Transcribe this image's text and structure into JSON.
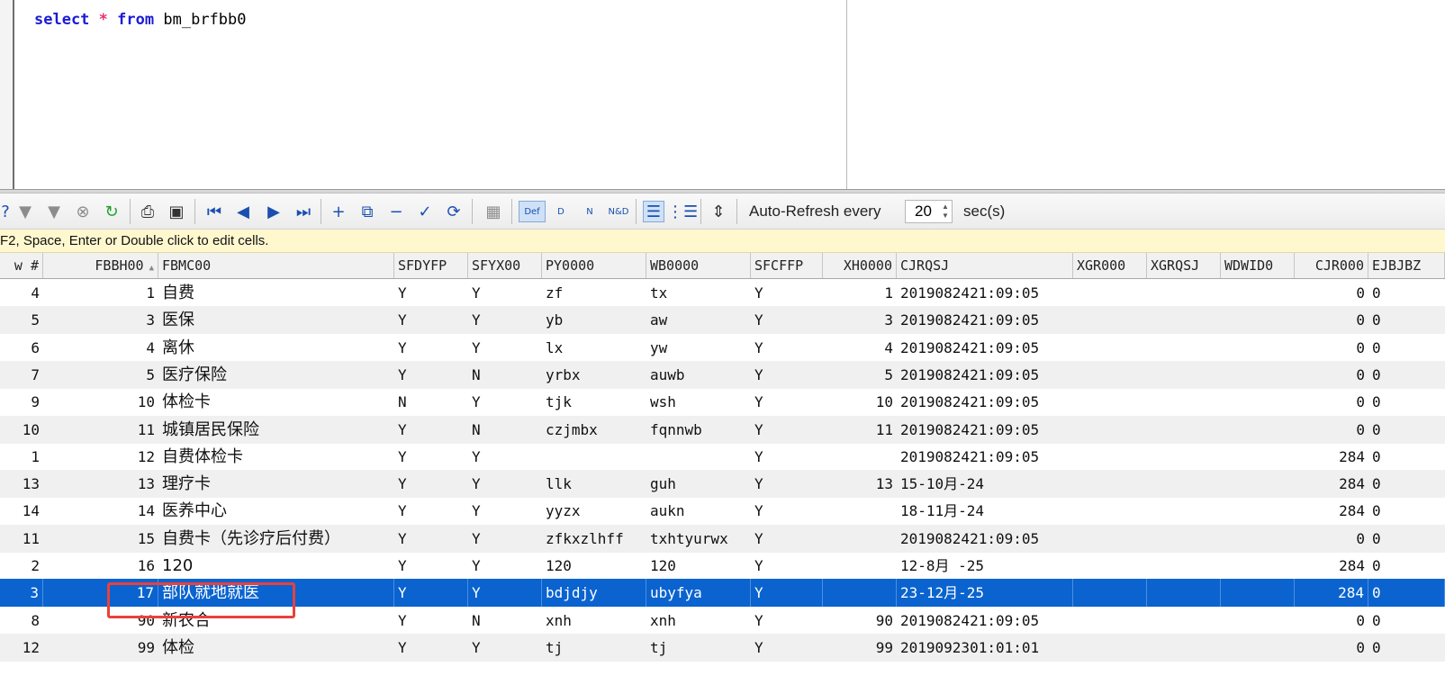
{
  "editor": {
    "sql_keyword_select": "select",
    "sql_star": "*",
    "sql_keyword_from": "from",
    "sql_table": "bm_brfbb0"
  },
  "toolbar": {
    "icons": [
      "help-icon",
      "filter-icon",
      "clear-filter-icon",
      "cancel-icon",
      "refresh-icon",
      "print-icon",
      "save-icon",
      "first-record-icon",
      "prior-record-icon",
      "next-record-icon",
      "last-record-icon",
      "insert-icon",
      "duplicate-icon",
      "delete-icon",
      "post-icon",
      "refresh-record-icon",
      "clear-icon",
      "default-view-icon",
      "d-view-icon",
      "n-view-icon",
      "nd-view-icon",
      "grid-view-icon",
      "form-view-icon",
      "fit-columns-icon"
    ],
    "btn_def_label": "Def",
    "btn_d_label": "D",
    "btn_n_label": "N",
    "btn_nd_label": "N&D",
    "auto_refresh_label": "Auto-Refresh every",
    "auto_refresh_value": "20",
    "auto_refresh_unit": "sec(s)"
  },
  "hint": "F2, Space, Enter or Double click to edit cells.",
  "grid": {
    "columns": [
      "w #",
      "FBBH00",
      "FBMC00",
      "SFDYFP",
      "SFYX00",
      "PY0000",
      "WB0000",
      "SFCFFP",
      "XH0000",
      "CJRQSJ",
      "XGR000",
      "XGRQSJ",
      "WDWID0",
      "CJR000",
      "EJBJBZ"
    ],
    "sort_indicator": "▲",
    "selected_row_index": 11,
    "rows": [
      {
        "rownum": "4",
        "fbbh": "1",
        "fbmc": "自费",
        "sfdyfp": "Y",
        "sfyx": "Y",
        "py": "zf",
        "wb": "tx",
        "sfcffp": "Y",
        "xh": "1",
        "cjrqsj": "2019082421:09:05",
        "xgr": "",
        "xgrqsj": "",
        "wdwid": "",
        "cjr": "0",
        "ejbjbz": "0"
      },
      {
        "rownum": "5",
        "fbbh": "3",
        "fbmc": "医保",
        "sfdyfp": "Y",
        "sfyx": "Y",
        "py": "yb",
        "wb": "aw",
        "sfcffp": "Y",
        "xh": "3",
        "cjrqsj": "2019082421:09:05",
        "xgr": "",
        "xgrqsj": "",
        "wdwid": "",
        "cjr": "0",
        "ejbjbz": "0"
      },
      {
        "rownum": "6",
        "fbbh": "4",
        "fbmc": "离休",
        "sfdyfp": "Y",
        "sfyx": "Y",
        "py": "lx",
        "wb": "yw",
        "sfcffp": "Y",
        "xh": "4",
        "cjrqsj": "2019082421:09:05",
        "xgr": "",
        "xgrqsj": "",
        "wdwid": "",
        "cjr": "0",
        "ejbjbz": "0"
      },
      {
        "rownum": "7",
        "fbbh": "5",
        "fbmc": "医疗保险",
        "sfdyfp": "Y",
        "sfyx": "N",
        "py": "yrbx",
        "wb": "auwb",
        "sfcffp": "Y",
        "xh": "5",
        "cjrqsj": "2019082421:09:05",
        "xgr": "",
        "xgrqsj": "",
        "wdwid": "",
        "cjr": "0",
        "ejbjbz": "0"
      },
      {
        "rownum": "9",
        "fbbh": "10",
        "fbmc": "体检卡",
        "sfdyfp": "N",
        "sfyx": "Y",
        "py": "tjk",
        "wb": "wsh",
        "sfcffp": "Y",
        "xh": "10",
        "cjrqsj": "2019082421:09:05",
        "xgr": "",
        "xgrqsj": "",
        "wdwid": "",
        "cjr": "0",
        "ejbjbz": "0"
      },
      {
        "rownum": "10",
        "fbbh": "11",
        "fbmc": "城镇居民保险",
        "sfdyfp": "Y",
        "sfyx": "N",
        "py": "czjmbx",
        "wb": "fqnnwb",
        "sfcffp": "Y",
        "xh": "11",
        "cjrqsj": "2019082421:09:05",
        "xgr": "",
        "xgrqsj": "",
        "wdwid": "",
        "cjr": "0",
        "ejbjbz": "0"
      },
      {
        "rownum": "1",
        "fbbh": "12",
        "fbmc": "自费体检卡",
        "sfdyfp": "Y",
        "sfyx": "Y",
        "py": "",
        "wb": "",
        "sfcffp": "Y",
        "xh": "",
        "cjrqsj": "2019082421:09:05",
        "xgr": "",
        "xgrqsj": "",
        "wdwid": "",
        "cjr": "284",
        "ejbjbz": "0"
      },
      {
        "rownum": "13",
        "fbbh": "13",
        "fbmc": "理疗卡",
        "sfdyfp": "Y",
        "sfyx": "Y",
        "py": "llk",
        "wb": "guh",
        "sfcffp": "Y",
        "xh": "13",
        "cjrqsj": "15-10月-24",
        "xgr": "",
        "xgrqsj": "",
        "wdwid": "",
        "cjr": "284",
        "ejbjbz": "0"
      },
      {
        "rownum": "14",
        "fbbh": "14",
        "fbmc": "医养中心",
        "sfdyfp": "Y",
        "sfyx": "Y",
        "py": "yyzx",
        "wb": "aukn",
        "sfcffp": "Y",
        "xh": "",
        "cjrqsj": "18-11月-24",
        "xgr": "",
        "xgrqsj": "",
        "wdwid": "",
        "cjr": "284",
        "ejbjbz": "0"
      },
      {
        "rownum": "11",
        "fbbh": "15",
        "fbmc": "自费卡（先诊疗后付费）",
        "sfdyfp": "Y",
        "sfyx": "Y",
        "py": "zfkxzlhff",
        "wb": "txhtyurwx",
        "sfcffp": "Y",
        "xh": "",
        "cjrqsj": "2019082421:09:05",
        "xgr": "",
        "xgrqsj": "",
        "wdwid": "",
        "cjr": "0",
        "ejbjbz": "0"
      },
      {
        "rownum": "2",
        "fbbh": "16",
        "fbmc": "120",
        "sfdyfp": "Y",
        "sfyx": "Y",
        "py": "120",
        "wb": "120",
        "sfcffp": "Y",
        "xh": "",
        "cjrqsj": "12-8月 -25",
        "xgr": "",
        "xgrqsj": "",
        "wdwid": "",
        "cjr": "284",
        "ejbjbz": "0"
      },
      {
        "rownum": "3",
        "fbbh": "17",
        "fbmc": "部队就地就医",
        "sfdyfp": "Y",
        "sfyx": "Y",
        "py": "bdjdjy",
        "wb": "ubyfya",
        "sfcffp": "Y",
        "xh": "",
        "cjrqsj": "23-12月-25",
        "xgr": "",
        "xgrqsj": "",
        "wdwid": "",
        "cjr": "284",
        "ejbjbz": "0"
      },
      {
        "rownum": "8",
        "fbbh": "90",
        "fbmc": "新农合",
        "sfdyfp": "Y",
        "sfyx": "N",
        "py": "xnh",
        "wb": "xnh",
        "sfcffp": "Y",
        "xh": "90",
        "cjrqsj": "2019082421:09:05",
        "xgr": "",
        "xgrqsj": "",
        "wdwid": "",
        "cjr": "0",
        "ejbjbz": "0"
      },
      {
        "rownum": "12",
        "fbbh": "99",
        "fbmc": "体检",
        "sfdyfp": "Y",
        "sfyx": "Y",
        "py": "tj",
        "wb": "tj",
        "sfcffp": "Y",
        "xh": "99",
        "cjrqsj": "2019092301:01:01",
        "xgr": "",
        "xgrqsj": "",
        "wdwid": "",
        "cjr": "0",
        "ejbjbz": "0"
      }
    ]
  },
  "colors": {
    "selection": "#0a63cf",
    "highlight_box": "#e8413c",
    "hint_bg": "#fff8cf",
    "keyword": "#1b1bd6",
    "star": "#e8336b"
  }
}
